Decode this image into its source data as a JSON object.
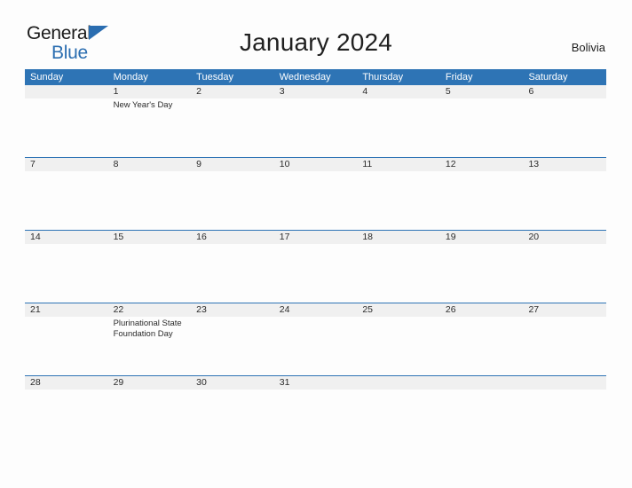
{
  "brand": {
    "name_part1": "General",
    "name_part2": "Blue",
    "triangle_color": "#2a6db0"
  },
  "header": {
    "title": "January 2024",
    "region": "Bolivia"
  },
  "colors": {
    "header_band": "#2e74b5",
    "date_band": "#f0f0f0",
    "rule": "#2e74b5",
    "text": "#2b2b2b",
    "accent": "#2a6db0"
  },
  "calendar": {
    "month": "January",
    "year": "2024",
    "weekday_headers": [
      "Sunday",
      "Monday",
      "Tuesday",
      "Wednesday",
      "Thursday",
      "Friday",
      "Saturday"
    ],
    "weeks": [
      {
        "days": [
          {
            "num": "",
            "events": []
          },
          {
            "num": "1",
            "events": [
              "New Year's Day"
            ]
          },
          {
            "num": "2",
            "events": []
          },
          {
            "num": "3",
            "events": []
          },
          {
            "num": "4",
            "events": []
          },
          {
            "num": "5",
            "events": []
          },
          {
            "num": "6",
            "events": []
          }
        ]
      },
      {
        "days": [
          {
            "num": "7",
            "events": []
          },
          {
            "num": "8",
            "events": []
          },
          {
            "num": "9",
            "events": []
          },
          {
            "num": "10",
            "events": []
          },
          {
            "num": "11",
            "events": []
          },
          {
            "num": "12",
            "events": []
          },
          {
            "num": "13",
            "events": []
          }
        ]
      },
      {
        "days": [
          {
            "num": "14",
            "events": []
          },
          {
            "num": "15",
            "events": []
          },
          {
            "num": "16",
            "events": []
          },
          {
            "num": "17",
            "events": []
          },
          {
            "num": "18",
            "events": []
          },
          {
            "num": "19",
            "events": []
          },
          {
            "num": "20",
            "events": []
          }
        ]
      },
      {
        "days": [
          {
            "num": "21",
            "events": []
          },
          {
            "num": "22",
            "events": [
              "Plurinational State Foundation Day"
            ]
          },
          {
            "num": "23",
            "events": []
          },
          {
            "num": "24",
            "events": []
          },
          {
            "num": "25",
            "events": []
          },
          {
            "num": "26",
            "events": []
          },
          {
            "num": "27",
            "events": []
          }
        ]
      },
      {
        "days": [
          {
            "num": "28",
            "events": []
          },
          {
            "num": "29",
            "events": []
          },
          {
            "num": "30",
            "events": []
          },
          {
            "num": "31",
            "events": []
          },
          {
            "num": "",
            "events": []
          },
          {
            "num": "",
            "events": []
          },
          {
            "num": "",
            "events": []
          }
        ]
      }
    ]
  }
}
